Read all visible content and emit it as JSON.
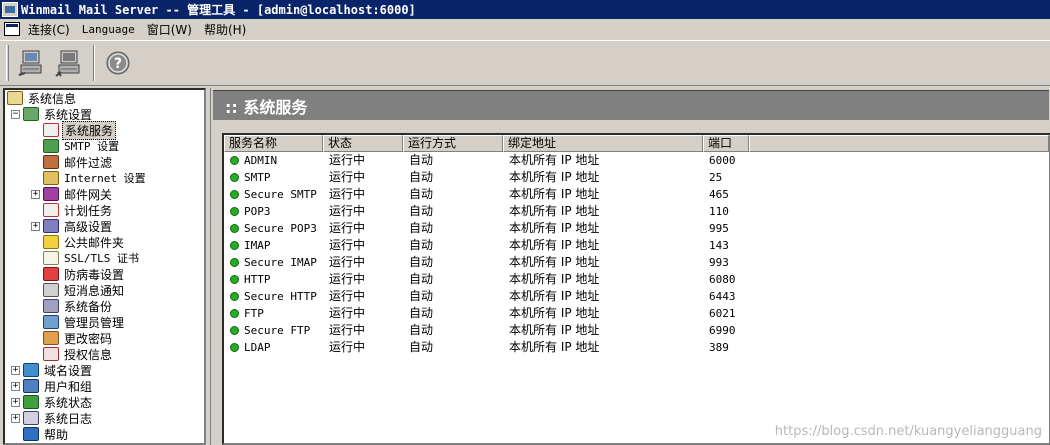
{
  "window": {
    "title": "Winmail Mail Server -- 管理工具 - [admin@localhost:6000]"
  },
  "menu": [
    {
      "label": "连接(C)",
      "name": "menu-connect"
    },
    {
      "label": "Language",
      "name": "menu-language"
    },
    {
      "label": "窗口(W)",
      "name": "menu-window"
    },
    {
      "label": "帮助(H)",
      "name": "menu-help"
    }
  ],
  "toolbar": {
    "buttons": [
      {
        "name": "connect-button",
        "icon": "computer-connect-icon"
      },
      {
        "name": "disconnect-button",
        "icon": "computer-disconnect-icon"
      },
      {
        "name": "help-button",
        "icon": "help-icon"
      }
    ]
  },
  "tree": {
    "root": "系统信息",
    "system_settings": "系统设置",
    "children": [
      "系统服务",
      "SMTP 设置",
      "邮件过滤",
      "Internet 设置",
      "邮件网关",
      "计划任务",
      "高级设置",
      "公共邮件夹",
      "SSL/TLS 证书",
      "防病毒设置",
      "短消息通知",
      "系统备份",
      "管理员管理",
      "更改密码",
      "授权信息"
    ],
    "top_level": [
      "域名设置",
      "用户和组",
      "系统状态",
      "系统日志",
      "帮助"
    ]
  },
  "panel": {
    "title": ":: 系统服务"
  },
  "table": {
    "columns": [
      "服务名称",
      "状态",
      "运行方式",
      "绑定地址",
      "端口"
    ],
    "rows": [
      [
        "ADMIN",
        "运行中",
        "自动",
        "本机所有 IP 地址",
        "6000"
      ],
      [
        "SMTP",
        "运行中",
        "自动",
        "本机所有 IP 地址",
        "25"
      ],
      [
        "Secure SMTP",
        "运行中",
        "自动",
        "本机所有 IP 地址",
        "465"
      ],
      [
        "POP3",
        "运行中",
        "自动",
        "本机所有 IP 地址",
        "110"
      ],
      [
        "Secure POP3",
        "运行中",
        "自动",
        "本机所有 IP 地址",
        "995"
      ],
      [
        "IMAP",
        "运行中",
        "自动",
        "本机所有 IP 地址",
        "143"
      ],
      [
        "Secure IMAP",
        "运行中",
        "自动",
        "本机所有 IP 地址",
        "993"
      ],
      [
        "HTTP",
        "运行中",
        "自动",
        "本机所有 IP 地址",
        "6080"
      ],
      [
        "Secure HTTP",
        "运行中",
        "自动",
        "本机所有 IP 地址",
        "6443"
      ],
      [
        "FTP",
        "运行中",
        "自动",
        "本机所有 IP 地址",
        "6021"
      ],
      [
        "Secure FTP",
        "运行中",
        "自动",
        "本机所有 IP 地址",
        "6990"
      ],
      [
        "LDAP",
        "运行中",
        "自动",
        "本机所有 IP 地址",
        "389"
      ]
    ]
  },
  "watermark": "https://blog.csdn.net/kuangyeliangguang",
  "colors": {
    "titlebar": "#0a246a",
    "chrome": "#d4d0c8",
    "running": "#22b022"
  }
}
